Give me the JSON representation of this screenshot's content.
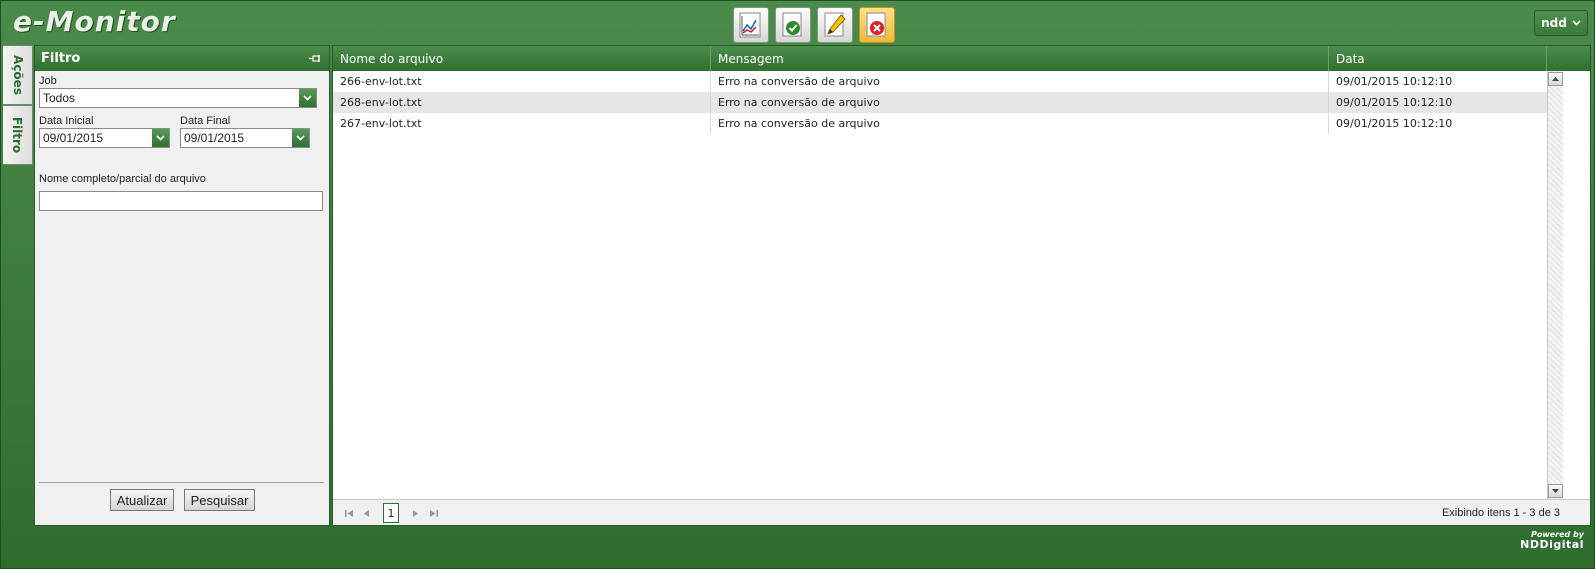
{
  "app": {
    "title": "e-Monitor"
  },
  "toolbar": {
    "tools": [
      {
        "icon": "chart-icon"
      },
      {
        "icon": "check-document-icon"
      },
      {
        "icon": "edit-document-icon"
      },
      {
        "icon": "error-document-icon",
        "active": true
      }
    ]
  },
  "user": {
    "name": "ndd"
  },
  "side_tabs": {
    "actions": "Ações",
    "filter": "Filtro"
  },
  "filter_panel": {
    "title": "Filtro",
    "job_label": "Job",
    "job_value": "Todos",
    "start_date_label": "Data Inicial",
    "start_date_value": "09/01/2015",
    "end_date_label": "Data Final",
    "end_date_value": "09/01/2015",
    "filename_label": "Nome completo/parcial do arquivo",
    "filename_value": "",
    "refresh_label": "Atualizar",
    "search_label": "Pesquisar"
  },
  "grid": {
    "columns": [
      "Nome do arquivo",
      "Mensagem",
      "Data"
    ],
    "rows": [
      {
        "file": "266-env-lot.txt",
        "message": "Erro na conversão de arquivo",
        "date": "09/01/2015 10:12:10"
      },
      {
        "file": "268-env-lot.txt",
        "message": "Erro na conversão de arquivo",
        "date": "09/01/2015 10:12:10"
      },
      {
        "file": "267-env-lot.txt",
        "message": "Erro na conversão de arquivo",
        "date": "09/01/2015 10:12:10"
      }
    ],
    "pager": {
      "current_page": "1",
      "info": "Exibindo itens 1 - 3 de 3"
    }
  },
  "footer": {
    "powered_by": "Powered by",
    "brand": "NDDigital"
  },
  "colors": {
    "accent": "#3f7f3f",
    "header_dark": "#2f6f2f",
    "active_tool": "#f0b838"
  }
}
